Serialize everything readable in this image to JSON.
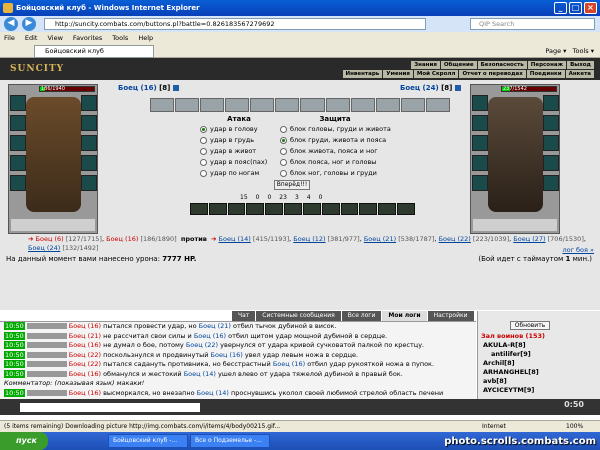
{
  "window": {
    "title": "Бойцовский клуб - Windows Internet Explorer"
  },
  "address": {
    "url": "http://suncity.combats.com/buttons.pl?battle=0.826183567279692",
    "search_placeholder": "QIP Search"
  },
  "menu": [
    "File",
    "Edit",
    "View",
    "Favorites",
    "Tools",
    "Help"
  ],
  "tab": {
    "label": "Бойцовский клуб"
  },
  "toolbar": {
    "page": "Page",
    "tools": "Tools"
  },
  "game": {
    "logo": "SUNCITY",
    "topmenu_row1": [
      "Знания",
      "Общение",
      "Безопасность",
      "Персонаж",
      "Выход"
    ],
    "topmenu_row2": [
      "Инвентарь",
      "Умения",
      "Мой Скролл",
      "Отчет о переводах",
      "Поединки",
      "Анкета"
    ]
  },
  "fighter_left": {
    "name": "Боец",
    "level": "(16)",
    "index": "[8]",
    "hp": "186/1940",
    "hp_fraction": 0.1
  },
  "fighter_right": {
    "name": "Боец",
    "level": "(24)",
    "index": "[8]",
    "hp": "237/1542",
    "hp_fraction": 0.15
  },
  "attack": {
    "title": "Атака",
    "options": [
      "удар в голову",
      "удар в грудь",
      "удар в живот",
      "удар в пояс(пах)",
      "удар по ногам"
    ]
  },
  "defense": {
    "title": "Защита",
    "options": [
      "блок головы, груди и живота",
      "блок груди, живота и пояса",
      "блок живота, пояса и ног",
      "блок пояса, ног и головы",
      "блок ног, головы и груди"
    ]
  },
  "go_button": "Вперёд!!!",
  "stats": [
    "15",
    "0",
    "0",
    "23",
    "3",
    "4",
    "0"
  ],
  "vs": {
    "left": [
      "Боец (6)",
      "[127/1715]",
      "Боец (16)",
      "[186/1890]"
    ],
    "word": "против",
    "right": [
      "Боец (14)",
      "[415/1193]",
      "Боец (12)",
      "[381/977]",
      "Боец (21)",
      "[538/1787]",
      "Боец (22)",
      "[223/1039]",
      "Боец (27)",
      "[706/1530]",
      "Боец (24)",
      "[132/1492]"
    ]
  },
  "log_link": "лог боя »",
  "damage": {
    "label": "На данный момент вами нанесено урона:",
    "value": "7777 HP."
  },
  "timeout": {
    "text": "(Бой идет с таймаутом",
    "value": "1",
    "unit": "мин.)"
  },
  "chat_tabs": [
    "Чат",
    "Системные сообщения",
    "Все логи",
    "Мои логи",
    "Настройки"
  ],
  "chat": [
    {
      "time": "10:50",
      "a": "Боец (16)",
      "msg": " пытался провести удар, но ",
      "b": "Боец (21)",
      "rest": " отбил тычок дубиной в висок."
    },
    {
      "time": "10:50",
      "a": "Боец (21)",
      "msg": " не рассчитал свои силы и ",
      "b": "Боец (16)",
      "rest": " отбил щитом удар мощной дубиной в сердце."
    },
    {
      "time": "10:50",
      "a": "Боец (16)",
      "msg": " не думал о бое, потому ",
      "b": "Боец (22)",
      "rest": " увернулся от удара кривой сучковатой палкой по крестцу."
    },
    {
      "time": "10:50",
      "a": "Боец (22)",
      "msg": " поскользнулся и продвинутый ",
      "b": "Боец (16)",
      "rest": " увел удар левым ножа в сердце."
    },
    {
      "time": "10:50",
      "a": "Боец (22)",
      "msg": " пытался садануть противника, но бесстрастный ",
      "b": "Боец (16)",
      "rest": " отбил удар рукояткой ножа в пупок."
    },
    {
      "time": "10:50",
      "a": "Боец (16)",
      "msg": " обманулся и жестокий ",
      "b": "Боец (14)",
      "rest": " ушел влево от удара тяжелой дубиной в правый бок."
    },
    {
      "time": "",
      "a": "",
      "msg": "Комментатор: (показывая язык) макаки!",
      "b": "",
      "rest": ""
    },
    {
      "time": "10:50",
      "a": "Боец (16)",
      "msg": " высморкался, но внезапно ",
      "b": "Боец (14)",
      "rest": " проснувшись уколол своей любимой стрелой область печени"
    }
  ],
  "side": {
    "refresh": "Обновить",
    "header": "Зал воинов (153)",
    "users": [
      "AKULA-R[8]",
      "antilifer[9]",
      "Archil[8]",
      "ARHANGHEL[8]",
      "avb[8]",
      "AYCICEYTM[9]"
    ]
  },
  "clock": "0:50",
  "status": {
    "left": "(5 items remaining) Downloading picture http://img.combats.com/i/items/4/body00215.gif...",
    "zone": "Internet",
    "zoom": "100%"
  },
  "taskbar": {
    "start": "пуск",
    "tasks": [
      "Бойцовский клуб -...",
      "Все о Подземелье -..."
    ],
    "watermark": "photo.scrolls.combats.com"
  }
}
